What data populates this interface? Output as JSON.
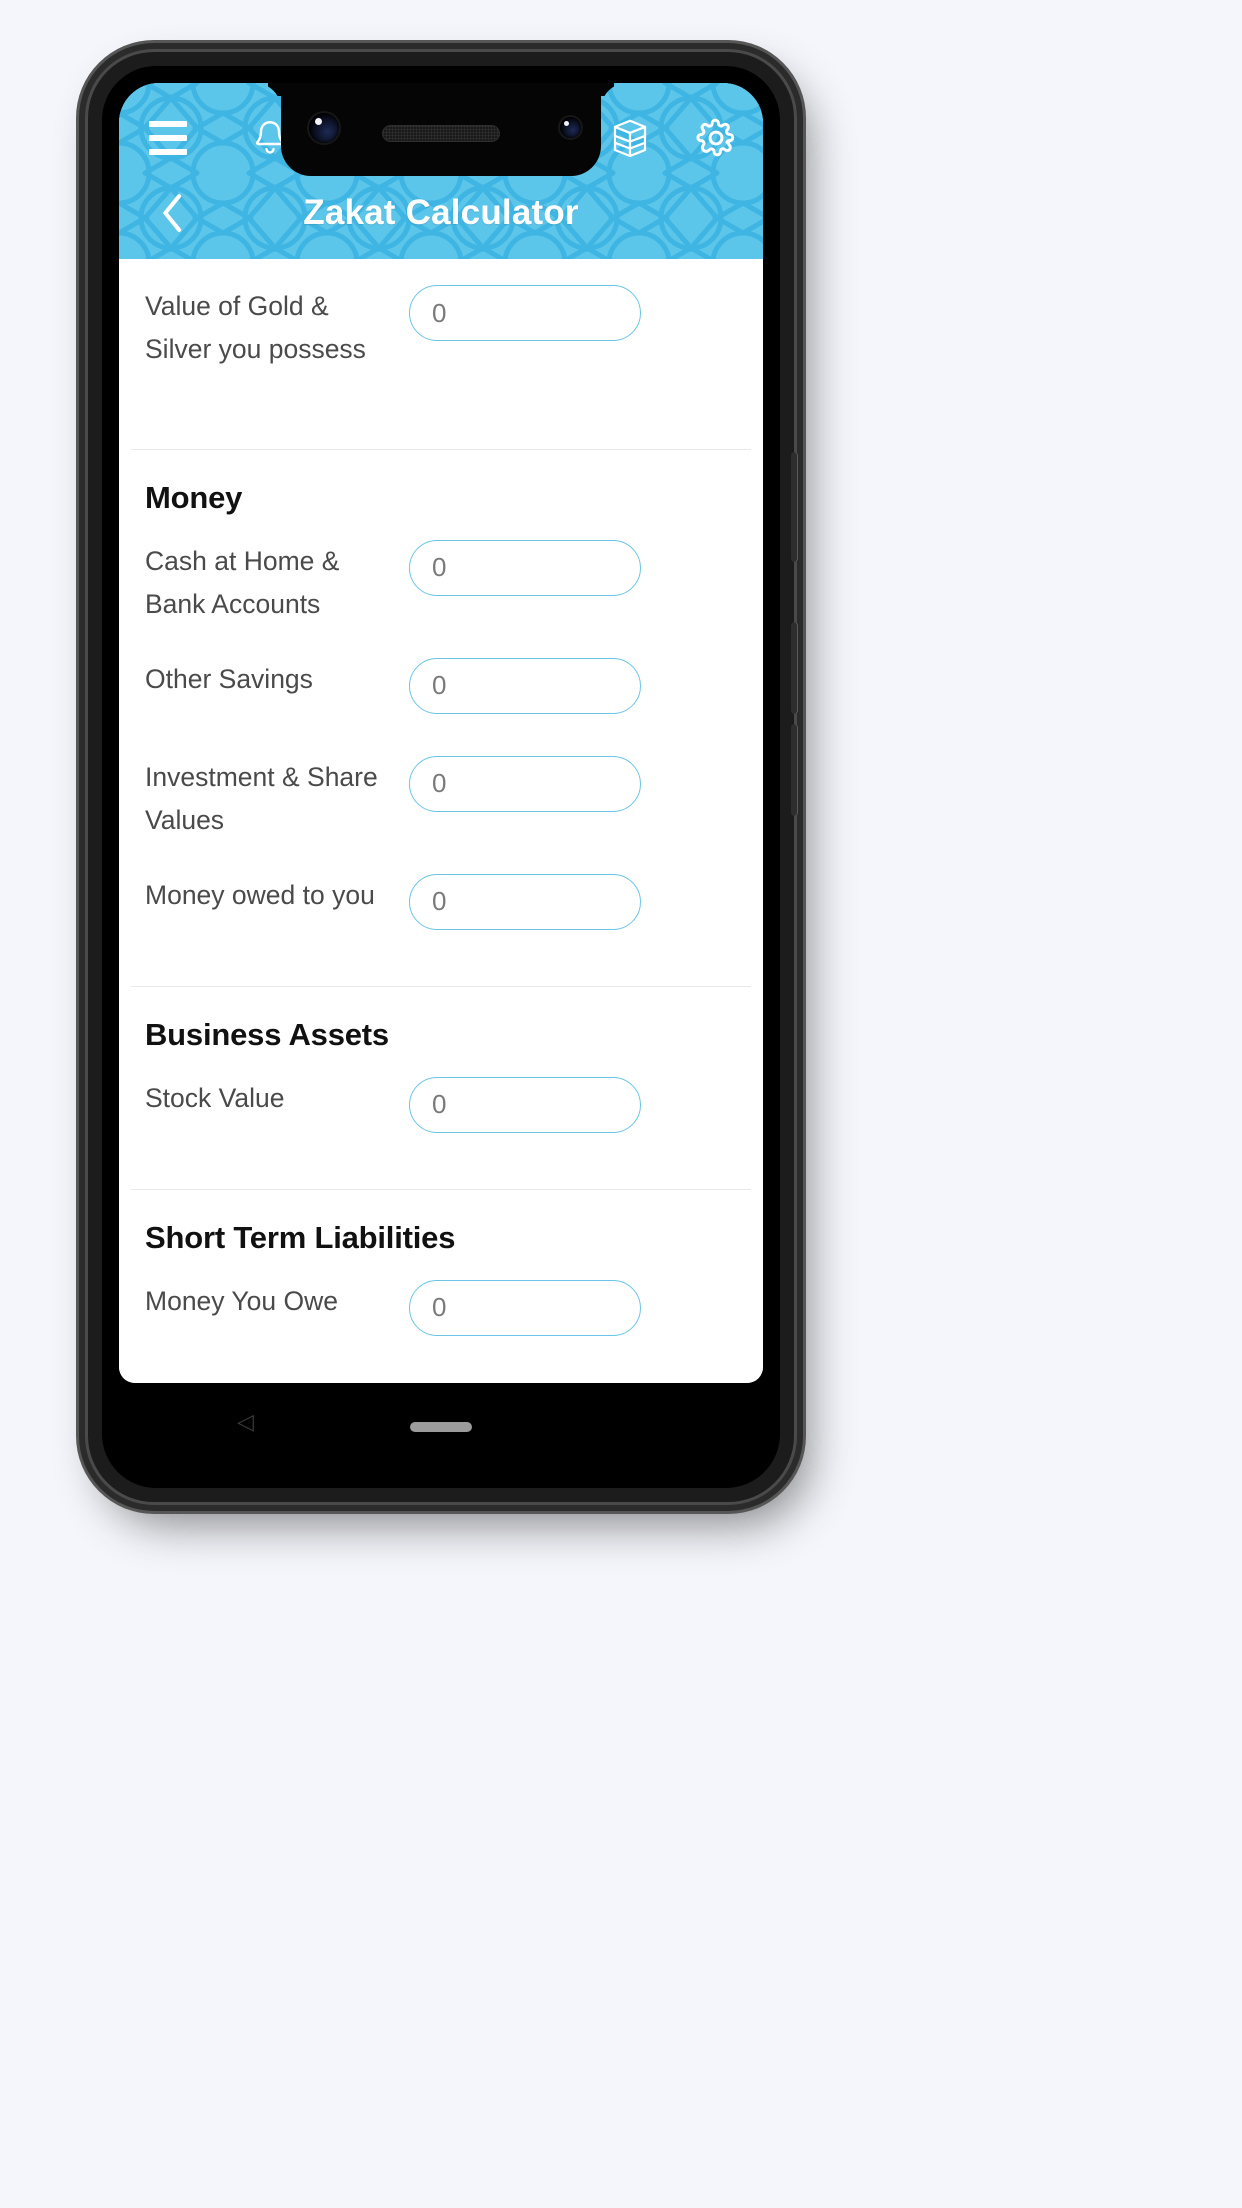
{
  "app": {
    "title": "Zakat Calculator",
    "accent_color": "#5cc5ea",
    "pattern_color": "#3bb3e0",
    "input_border_color": "#6cc5e6"
  },
  "topbar": {
    "menu_icon": "hamburger-menu-icon",
    "notifications_icon": "bell-icon",
    "qibla_icon": "kaaba-icon",
    "settings_icon": "gear-icon"
  },
  "titlebar": {
    "back_icon": "chevron-left-icon",
    "title": "Zakat Calculator"
  },
  "form": {
    "sections": [
      {
        "id": "gold-silver",
        "heading": null,
        "rows": [
          {
            "label": "Value of Gold & Silver you possess",
            "value": "",
            "placeholder": "0"
          }
        ]
      },
      {
        "id": "money",
        "heading": "Money",
        "rows": [
          {
            "label": "Cash at Home & Bank Accounts",
            "value": "",
            "placeholder": "0"
          },
          {
            "label": "Other Savings",
            "value": "",
            "placeholder": "0"
          },
          {
            "label": "Investment & Share Values",
            "value": "",
            "placeholder": "0"
          },
          {
            "label": "Money owed to you",
            "value": "",
            "placeholder": "0"
          }
        ]
      },
      {
        "id": "business-assets",
        "heading": "Business Assets",
        "rows": [
          {
            "label": "Stock Value",
            "value": "",
            "placeholder": "0"
          }
        ]
      },
      {
        "id": "short-term-liabilities",
        "heading": "Short Term Liabilities",
        "rows": [
          {
            "label": "Money You Owe",
            "value": "",
            "placeholder": "0"
          }
        ]
      }
    ]
  },
  "navbar": {
    "back_glyph": "◁",
    "gesture_pill": "home-gesture-pill"
  }
}
